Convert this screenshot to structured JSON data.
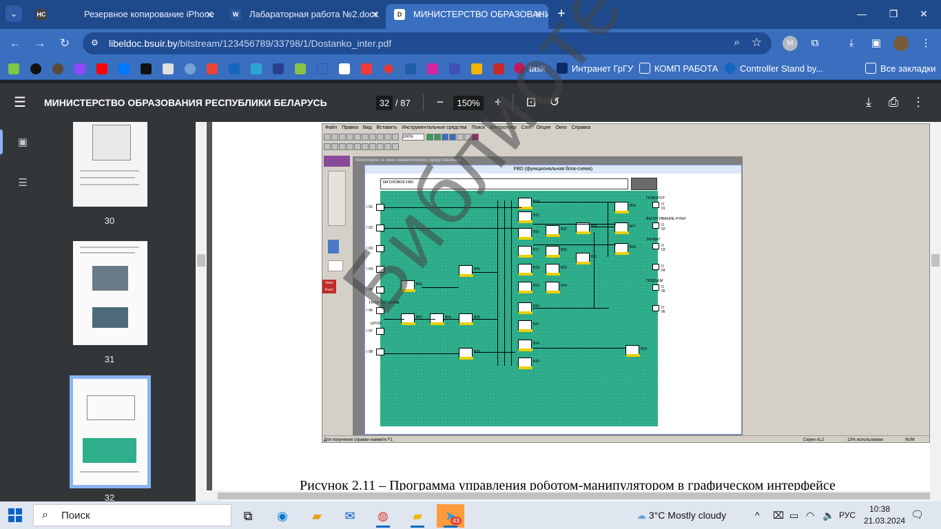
{
  "browser": {
    "tabs": [
      {
        "label": "Резервное копирование iPhone",
        "icon": "apple-icon"
      },
      {
        "label": "Лабараторная работа №2.docx",
        "icon": "word-icon"
      },
      {
        "label": "МИНИСТЕРСТВО ОБРАЗОВАНИЯ",
        "icon": "doc-d-icon"
      }
    ],
    "tab_menu_label": "НС",
    "url_host": "libeldoc.bsuir.by",
    "url_path": "/bitstream/123456789/33798/1/Dostanko_inter.pdf",
    "profile_initial": "M",
    "bookmarks": [
      "task",
      "Интранет ГрГУ",
      "КОМП РАБОТА",
      "Controller Stand by...",
      "Все закладки"
    ]
  },
  "pdf": {
    "title": "МИНИСТЕРСТВО ОБРАЗОВАНИЯ РЕСПУБЛИКИ БЕЛАРУСЬ",
    "current_page": "32",
    "total_pages": "/ 87",
    "zoom": "150%",
    "thumbnails": [
      "30",
      "31",
      "32"
    ]
  },
  "document": {
    "caption": "Рисунок 2.11 – Программа управления роботом-манипулятором в графическом интерфейсе",
    "watermark": "Библиотека",
    "shot": {
      "menu": [
        "Файл",
        "Правка",
        "Вид",
        "Вставить",
        "Инструментальные средства",
        "Поиск",
        "Контроллер",
        "Com",
        "Опция",
        "Окно",
        "Справка"
      ],
      "zoom_value": "100%",
      "background_window_title": "Мониторинг в окне схематического представления",
      "fbd_title": "FBD (функциональная блок-схема)",
      "header_label": "ЗАГОЛОВОК FBD",
      "inputs": [
        "I 01",
        "I 02",
        "I 03",
        "I 04",
        "I 05",
        "I 06",
        "I 07",
        "I 08"
      ],
      "outputs": [
        "O 01",
        "O 02",
        "O 03",
        "O 04",
        "O 05",
        "O 06"
      ],
      "output_labels": [
        "ПОВОРОТ",
        "ВЫТЯГИВАНИЕ РУКИ",
        "ЗАХВАТ",
        "",
        "ПОДЪЕМ",
        ""
      ],
      "input_labels": {
        "i06": "ПУСК-ОСТАНОВ",
        "i07": "ШТОК"
      },
      "blocks": [
        "B14",
        "B15",
        "B16",
        "B17",
        "B18",
        "B19",
        "B20",
        "B21",
        "B24",
        "B26",
        "B01",
        "B02",
        "B03",
        "B04",
        "B05",
        "B06",
        "B07",
        "B08",
        "B09",
        "B10",
        "B11",
        "B12",
        "B13",
        "B22",
        "B23",
        "B25",
        "B27",
        "B28",
        "B29",
        "B30",
        "B31",
        "B32",
        "B33",
        "B34",
        "B35"
      ],
      "status_help": "Для получения справки нажмите F1",
      "status_series": "Серии AL2",
      "status_usage": "13% использовано",
      "status_num": "NUM",
      "user_func": "User Func"
    }
  },
  "taskbar": {
    "search_placeholder": "Поиск",
    "weather": "3°C  Mostly cloudy",
    "lang": "РУС",
    "time": "10:38",
    "date": "21.03.2024",
    "telegram_badge": "43"
  },
  "colors": {
    "tabstrip": "#1e4a8c",
    "toolbar": "#3a6fc0",
    "pdf_toolbar": "#323639",
    "fbd_grid": "#2fae8c",
    "accent": "#8ab4f8"
  }
}
